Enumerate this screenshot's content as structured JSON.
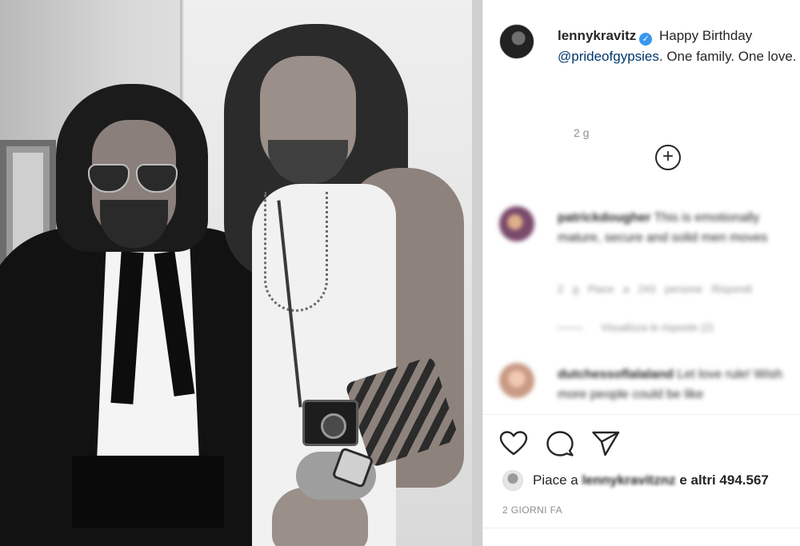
{
  "post": {
    "username": "lennykravitz",
    "caption_text": "Happy Birthday",
    "mention": "@prideofgypsies",
    "caption_rest": ". One family. One love.",
    "age": "2 g"
  },
  "comments": [
    {
      "username": "patrickdougher",
      "text": "This is emotionally mature, secure and solid men moves",
      "age": "2 g",
      "likes": "Piace a 243 persone",
      "reply": "Rispondi",
      "view_replies": "Visualizza le risposte (2)"
    },
    {
      "username": "dutchessoflalaland",
      "text": "Let love rule! Wish more people could be like"
    }
  ],
  "likes": {
    "prefix": "Piace a",
    "liker": "lennykravitznz",
    "suffix": "e altri 494.567"
  },
  "date": "2 GIORNI FA",
  "icons": {
    "like": "heart-icon",
    "comment": "comment-icon",
    "share": "paper-plane-icon",
    "verified": "verified-badge-icon",
    "load_more": "plus-circle-icon"
  },
  "colors": {
    "mention": "#00376b",
    "verified": "#3897f0",
    "muted": "#8e8e8e"
  }
}
